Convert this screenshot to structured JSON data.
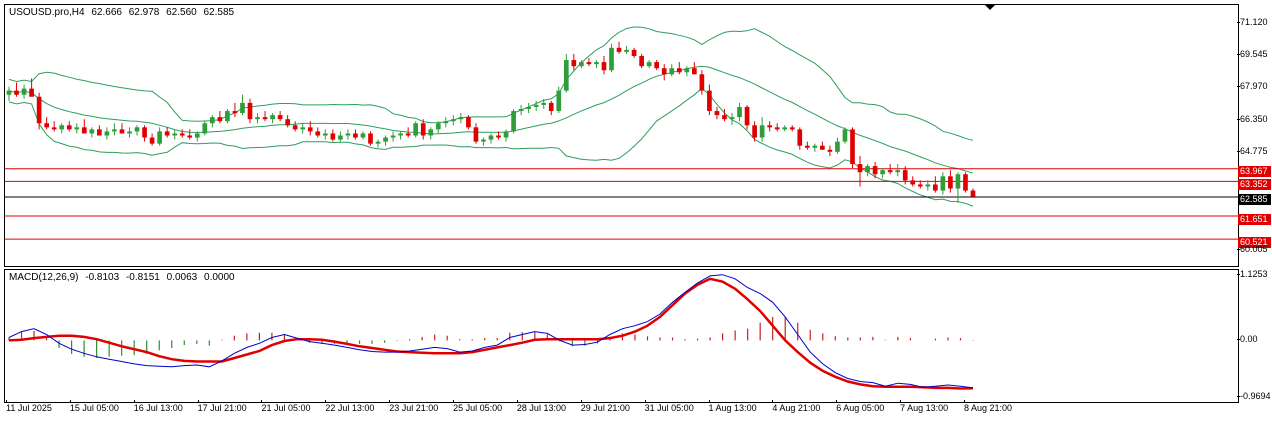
{
  "price_header": {
    "symbol_tf": "USOUSD.pro,H4",
    "open": "62.666",
    "high": "62.978",
    "low": "62.560",
    "close": "62.585"
  },
  "macd_header": {
    "name": "MACD(12,26,9)",
    "main": "-0.8103",
    "signal": "-0.8151",
    "histogram": "0.0063",
    "extra": "0.0000"
  },
  "price_axis_labels": [
    "71.120",
    "69.545",
    "67.970",
    "66.350",
    "64.775",
    "60.005"
  ],
  "price_axis_values": [
    71.12,
    69.545,
    67.97,
    66.35,
    64.775,
    60.005
  ],
  "macd_axis_labels": [
    "1.1253",
    "0.00",
    "-0.9694"
  ],
  "macd_axis_values": [
    1.1253,
    0,
    -0.9694
  ],
  "horizontal_lines": [
    {
      "label": "63.967",
      "value": 63.967,
      "color": "#e00000",
      "kind": "level"
    },
    {
      "label": "63.352",
      "value": 63.352,
      "color": "#e00000",
      "kind": "level"
    },
    {
      "label": "62.585",
      "value": 62.585,
      "color": "#000000",
      "kind": "bid"
    },
    {
      "label": "61.651",
      "value": 61.651,
      "color": "#e00000",
      "kind": "level"
    },
    {
      "label": "60.521",
      "value": 60.521,
      "color": "#e00000",
      "kind": "level"
    }
  ],
  "time_labels": [
    "11 Jul 2025",
    "15 Jul 05:00",
    "16 Jul 13:00",
    "17 Jul 21:00",
    "21 Jul 05:00",
    "22 Jul 13:00",
    "23 Jul 21:00",
    "25 Jul 05:00",
    "28 Jul 13:00",
    "29 Jul 21:00",
    "31 Jul 05:00",
    "1 Aug 13:00",
    "4 Aug 21:00",
    "6 Aug 05:00",
    "7 Aug 13:00",
    "8 Aug 21:00"
  ],
  "colors": {
    "bull": "#2e9e3a",
    "bear": "#e00000",
    "bands": "#2e9e5e",
    "macd_hist_pos": "#c82020",
    "macd_hist_neg": "#2e8b2e",
    "macd_main": "#0000cc",
    "macd_signal": "#e00000"
  },
  "chart_data": [
    {
      "type": "candlestick",
      "title": "USOUSD.pro,H4",
      "ylim": [
        59.2,
        72.0
      ],
      "candles_ohlc": [
        [
          67.6,
          68.0,
          67.3,
          67.8
        ],
        [
          67.8,
          68.2,
          67.5,
          67.6
        ],
        [
          67.6,
          68.1,
          67.4,
          67.9
        ],
        [
          67.9,
          68.4,
          67.6,
          67.5
        ],
        [
          67.5,
          67.7,
          65.9,
          66.2
        ],
        [
          66.2,
          66.5,
          65.9,
          66.0
        ],
        [
          66.0,
          66.3,
          65.8,
          65.9
        ],
        [
          65.9,
          66.2,
          65.7,
          66.1
        ],
        [
          66.1,
          66.3,
          65.8,
          65.9
        ],
        [
          65.9,
          66.2,
          65.7,
          66.0
        ],
        [
          66.0,
          66.4,
          65.8,
          65.7
        ],
        [
          65.7,
          66.0,
          65.5,
          65.9
        ],
        [
          65.9,
          66.1,
          65.6,
          65.6
        ],
        [
          65.6,
          66.0,
          65.4,
          65.8
        ],
        [
          65.8,
          66.2,
          65.6,
          65.9
        ],
        [
          65.9,
          66.2,
          65.7,
          65.7
        ],
        [
          65.7,
          66.0,
          65.5,
          65.8
        ],
        [
          65.8,
          66.1,
          65.6,
          66.0
        ],
        [
          66.0,
          66.1,
          65.3,
          65.5
        ],
        [
          65.5,
          65.7,
          65.1,
          65.2
        ],
        [
          65.2,
          66.0,
          65.1,
          65.8
        ],
        [
          65.8,
          66.0,
          65.5,
          65.6
        ],
        [
          65.6,
          65.9,
          65.4,
          65.7
        ],
        [
          65.7,
          65.9,
          65.5,
          65.6
        ],
        [
          65.6,
          65.9,
          65.4,
          65.5
        ],
        [
          65.5,
          65.8,
          65.3,
          65.7
        ],
        [
          65.7,
          66.3,
          65.6,
          66.2
        ],
        [
          66.2,
          66.6,
          66.0,
          66.5
        ],
        [
          66.5,
          66.8,
          66.2,
          66.3
        ],
        [
          66.3,
          66.9,
          66.2,
          66.8
        ],
        [
          66.8,
          67.2,
          66.5,
          66.7
        ],
        [
          66.7,
          67.6,
          66.6,
          67.2
        ],
        [
          67.2,
          67.4,
          66.2,
          66.4
        ],
        [
          66.4,
          66.7,
          66.2,
          66.5
        ],
        [
          66.5,
          66.8,
          66.3,
          66.4
        ],
        [
          66.4,
          66.7,
          66.2,
          66.6
        ],
        [
          66.6,
          66.8,
          66.3,
          66.4
        ],
        [
          66.4,
          66.6,
          66.0,
          66.1
        ],
        [
          66.1,
          66.3,
          65.8,
          65.9
        ],
        [
          65.9,
          66.2,
          65.7,
          66.0
        ],
        [
          66.0,
          66.3,
          65.6,
          65.8
        ],
        [
          65.8,
          66.0,
          65.5,
          65.6
        ],
        [
          65.6,
          65.9,
          65.4,
          65.7
        ],
        [
          65.7,
          65.9,
          65.3,
          65.4
        ],
        [
          65.4,
          65.8,
          65.3,
          65.6
        ],
        [
          65.6,
          65.9,
          65.4,
          65.7
        ],
        [
          65.7,
          65.9,
          65.4,
          65.5
        ],
        [
          65.5,
          65.8,
          65.4,
          65.7
        ],
        [
          65.7,
          65.8,
          65.1,
          65.2
        ],
        [
          65.2,
          65.4,
          65.0,
          65.3
        ],
        [
          65.3,
          65.6,
          65.1,
          65.5
        ],
        [
          65.5,
          65.8,
          65.3,
          65.6
        ],
        [
          65.6,
          65.8,
          65.4,
          65.7
        ],
        [
          65.7,
          66.0,
          65.5,
          65.6
        ],
        [
          65.6,
          66.3,
          65.5,
          66.2
        ],
        [
          66.2,
          66.4,
          65.4,
          65.6
        ],
        [
          65.6,
          66.0,
          65.4,
          65.9
        ],
        [
          65.9,
          66.3,
          65.7,
          66.2
        ],
        [
          66.2,
          66.5,
          66.0,
          66.3
        ],
        [
          66.3,
          66.6,
          66.1,
          66.4
        ],
        [
          66.4,
          66.7,
          66.2,
          66.5
        ],
        [
          66.5,
          66.6,
          65.9,
          66.0
        ],
        [
          66.0,
          66.2,
          65.2,
          65.3
        ],
        [
          65.3,
          65.5,
          65.1,
          65.4
        ],
        [
          65.4,
          65.7,
          65.2,
          65.6
        ],
        [
          65.6,
          65.8,
          65.4,
          65.5
        ],
        [
          65.5,
          65.9,
          65.3,
          65.8
        ],
        [
          65.8,
          66.9,
          65.7,
          66.8
        ],
        [
          66.8,
          67.1,
          66.6,
          66.9
        ],
        [
          66.9,
          67.2,
          66.7,
          67.0
        ],
        [
          67.0,
          67.3,
          66.8,
          67.1
        ],
        [
          67.1,
          67.4,
          66.9,
          67.2
        ],
        [
          67.2,
          67.3,
          66.6,
          66.8
        ],
        [
          66.8,
          68.0,
          66.7,
          67.8
        ],
        [
          67.8,
          69.6,
          67.7,
          69.3
        ],
        [
          69.3,
          69.6,
          68.8,
          69.0
        ],
        [
          69.0,
          69.3,
          68.9,
          69.2
        ],
        [
          69.2,
          69.4,
          69.0,
          69.1
        ],
        [
          69.1,
          69.3,
          68.9,
          69.2
        ],
        [
          69.2,
          69.5,
          68.6,
          68.8
        ],
        [
          68.8,
          70.1,
          68.7,
          69.9
        ],
        [
          69.9,
          70.2,
          69.6,
          69.7
        ],
        [
          69.7,
          70.0,
          69.6,
          69.8
        ],
        [
          69.8,
          69.9,
          69.4,
          69.5
        ],
        [
          69.5,
          69.6,
          68.9,
          69.0
        ],
        [
          69.0,
          69.3,
          68.9,
          69.2
        ],
        [
          69.2,
          69.3,
          68.8,
          68.9
        ],
        [
          68.9,
          69.1,
          68.3,
          68.6
        ],
        [
          68.6,
          69.1,
          68.5,
          68.9
        ],
        [
          68.9,
          69.2,
          68.6,
          68.7
        ],
        [
          68.7,
          69.0,
          68.5,
          68.9
        ],
        [
          68.9,
          69.2,
          68.7,
          68.6
        ],
        [
          68.6,
          68.8,
          67.6,
          67.8
        ],
        [
          67.8,
          68.1,
          66.6,
          66.8
        ],
        [
          66.8,
          67.0,
          66.4,
          66.6
        ],
        [
          66.6,
          66.9,
          66.3,
          66.4
        ],
        [
          66.4,
          66.7,
          66.1,
          66.5
        ],
        [
          66.5,
          67.2,
          66.3,
          67.0
        ],
        [
          67.0,
          67.1,
          65.9,
          66.1
        ],
        [
          66.1,
          66.3,
          65.3,
          65.5
        ],
        [
          65.5,
          66.5,
          65.3,
          66.1
        ],
        [
          66.1,
          66.3,
          65.8,
          66.0
        ],
        [
          66.0,
          66.2,
          65.8,
          65.9
        ],
        [
          65.9,
          66.1,
          65.8,
          66.0
        ],
        [
          66.0,
          66.1,
          65.8,
          65.9
        ],
        [
          65.9,
          66.0,
          64.9,
          65.1
        ],
        [
          65.1,
          65.3,
          64.9,
          65.0
        ],
        [
          65.0,
          65.2,
          64.8,
          65.1
        ],
        [
          65.1,
          65.3,
          64.9,
          64.9
        ],
        [
          64.9,
          65.1,
          64.6,
          64.8
        ],
        [
          64.8,
          65.5,
          64.7,
          65.3
        ],
        [
          65.3,
          66.0,
          65.2,
          65.9
        ],
        [
          65.9,
          66.0,
          64.0,
          64.2
        ],
        [
          64.2,
          64.6,
          63.1,
          63.8
        ],
        [
          63.8,
          64.2,
          63.6,
          64.1
        ],
        [
          64.1,
          64.3,
          63.5,
          63.7
        ],
        [
          63.7,
          64.0,
          63.5,
          63.9
        ],
        [
          63.9,
          64.2,
          63.7,
          63.8
        ],
        [
          63.8,
          64.2,
          63.6,
          63.9
        ],
        [
          63.9,
          64.1,
          63.2,
          63.4
        ],
        [
          63.4,
          63.6,
          63.1,
          63.2
        ],
        [
          63.2,
          63.4,
          63.0,
          63.1
        ],
        [
          63.1,
          63.4,
          62.9,
          63.2
        ],
        [
          63.2,
          63.6,
          62.8,
          62.9
        ],
        [
          62.9,
          63.8,
          62.7,
          63.6
        ],
        [
          63.6,
          63.9,
          62.8,
          63.0
        ],
        [
          63.0,
          63.8,
          62.3,
          63.7
        ],
        [
          63.7,
          63.8,
          62.8,
          62.9
        ],
        [
          62.9,
          63.0,
          62.6,
          62.6
        ]
      ]
    },
    {
      "type": "line",
      "title": "MACD(12,26,9)",
      "ylim": [
        -1.05,
        1.2
      ],
      "series": [
        {
          "name": "MACD",
          "values": [
            0.05,
            0.15,
            0.2,
            0.1,
            -0.05,
            -0.15,
            -0.22,
            -0.28,
            -0.32,
            -0.36,
            -0.4,
            -0.43,
            -0.44,
            -0.45,
            -0.43,
            -0.42,
            -0.45,
            -0.35,
            -0.22,
            -0.12,
            -0.05,
            0.05,
            0.1,
            0.04,
            -0.02,
            -0.05,
            -0.08,
            -0.12,
            -0.16,
            -0.19,
            -0.2,
            -0.2,
            -0.18,
            -0.15,
            -0.12,
            -0.14,
            -0.2,
            -0.18,
            -0.12,
            -0.08,
            0.05,
            0.1,
            0.15,
            0.12,
            0.0,
            -0.08,
            -0.07,
            -0.03,
            0.1,
            0.2,
            0.25,
            0.32,
            0.45,
            0.65,
            0.82,
            0.98,
            1.1,
            1.12,
            1.05,
            0.9,
            0.8,
            0.65,
            0.4,
            0.1,
            -0.2,
            -0.4,
            -0.55,
            -0.65,
            -0.7,
            -0.72,
            -0.78,
            -0.73,
            -0.75,
            -0.8,
            -0.78,
            -0.76,
            -0.78,
            -0.81
          ]
        },
        {
          "name": "Signal",
          "values": [
            0.0,
            0.01,
            0.04,
            0.06,
            0.08,
            0.08,
            0.06,
            0.02,
            -0.04,
            -0.1,
            -0.15,
            -0.2,
            -0.27,
            -0.32,
            -0.35,
            -0.36,
            -0.36,
            -0.36,
            -0.3,
            -0.24,
            -0.18,
            -0.08,
            -0.01,
            0.02,
            0.02,
            0.01,
            -0.02,
            -0.06,
            -0.1,
            -0.13,
            -0.16,
            -0.19,
            -0.2,
            -0.21,
            -0.22,
            -0.22,
            -0.22,
            -0.2,
            -0.16,
            -0.12,
            -0.08,
            -0.04,
            0.01,
            0.02,
            0.02,
            0.02,
            0.02,
            0.02,
            0.04,
            0.08,
            0.15,
            0.25,
            0.4,
            0.6,
            0.8,
            0.95,
            1.05,
            1.0,
            0.88,
            0.7,
            0.5,
            0.25,
            0.0,
            -0.2,
            -0.38,
            -0.52,
            -0.62,
            -0.7,
            -0.75,
            -0.78,
            -0.79,
            -0.79,
            -0.79,
            -0.8,
            -0.81,
            -0.81,
            -0.82,
            -0.8151
          ]
        },
        {
          "name": "Histogram",
          "values": [
            0.05,
            0.14,
            0.16,
            0.04,
            -0.13,
            -0.23,
            -0.28,
            -0.3,
            -0.28,
            -0.26,
            -0.25,
            -0.23,
            -0.17,
            -0.13,
            -0.08,
            -0.06,
            -0.09,
            0.01,
            0.08,
            0.12,
            0.13,
            0.13,
            0.11,
            0.02,
            -0.04,
            -0.06,
            -0.06,
            -0.06,
            -0.06,
            -0.06,
            -0.04,
            -0.01,
            0.02,
            0.06,
            0.1,
            0.08,
            0.02,
            0.02,
            0.04,
            0.04,
            0.13,
            0.14,
            0.14,
            0.1,
            -0.02,
            -0.1,
            -0.09,
            -0.05,
            0.06,
            0.12,
            0.1,
            0.07,
            0.05,
            0.05,
            0.02,
            0.03,
            0.05,
            0.12,
            0.17,
            0.2,
            0.3,
            0.4,
            0.4,
            0.3,
            0.18,
            0.12,
            0.07,
            0.05,
            0.05,
            0.06,
            0.01,
            0.06,
            0.04,
            0.0,
            0.03,
            0.05,
            0.04,
            0.0063
          ]
        }
      ]
    }
  ]
}
